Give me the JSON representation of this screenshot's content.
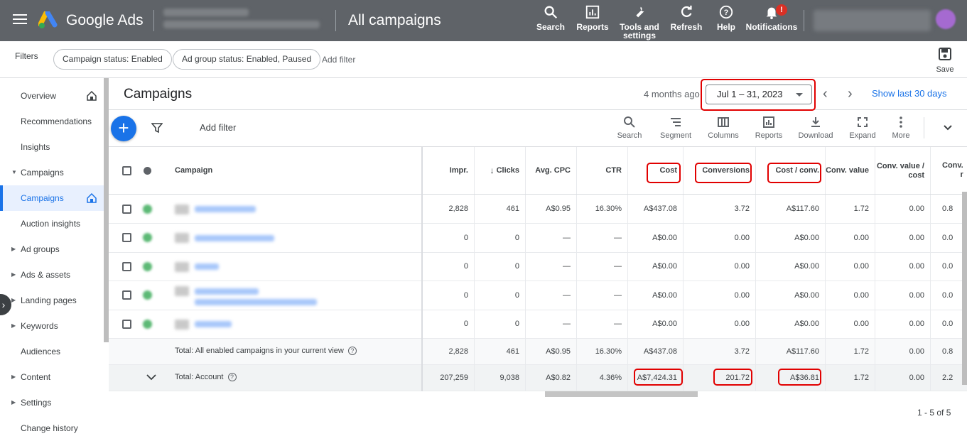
{
  "app": {
    "brand": "Google Ads",
    "page_title": "All campaigns"
  },
  "topnav": [
    {
      "label": "Search",
      "icon": "search-icon"
    },
    {
      "label": "Reports",
      "icon": "reports-icon"
    },
    {
      "label": "Tools and settings",
      "icon": "wrench-icon"
    },
    {
      "label": "Refresh",
      "icon": "refresh-icon"
    },
    {
      "label": "Help",
      "icon": "help-icon"
    },
    {
      "label": "Notifications",
      "icon": "bell-icon",
      "badge": "!"
    }
  ],
  "filterbar": {
    "label": "Filters",
    "chips": [
      "Campaign status: Enabled",
      "Ad group status: Enabled, Paused"
    ],
    "add_filter": "Add filter",
    "save": "Save"
  },
  "sidebar": {
    "items": [
      {
        "label": "Overview",
        "home": true
      },
      {
        "label": "Recommendations"
      },
      {
        "label": "Insights"
      },
      {
        "label": "Campaigns",
        "caret": "down"
      },
      {
        "label": "Campaigns",
        "active": true,
        "home": true
      },
      {
        "label": "Auction insights"
      },
      {
        "label": "Ad groups",
        "caret": "right"
      },
      {
        "label": "Ads & assets",
        "caret": "right"
      },
      {
        "label": "Landing pages",
        "caret": "right"
      },
      {
        "label": "Keywords",
        "caret": "right"
      },
      {
        "label": "Audiences"
      },
      {
        "label": "Content",
        "caret": "right"
      },
      {
        "label": "Settings",
        "caret": "right"
      },
      {
        "label": "Change history"
      }
    ]
  },
  "header": {
    "title": "Campaigns",
    "ago": "4 months ago",
    "date_range": "Jul 1 – 31, 2023",
    "show_last": "Show last 30 days"
  },
  "toolbar": {
    "add_filter": "Add filter",
    "tools": [
      {
        "label": "Search",
        "icon": "search-icon"
      },
      {
        "label": "Segment",
        "icon": "segment-icon"
      },
      {
        "label": "Columns",
        "icon": "columns-icon"
      },
      {
        "label": "Reports",
        "icon": "reports-icon"
      },
      {
        "label": "Download",
        "icon": "download-icon"
      },
      {
        "label": "Expand",
        "icon": "expand-icon"
      },
      {
        "label": "More",
        "icon": "more-vert-icon"
      }
    ]
  },
  "table": {
    "campaign_header": "Campaign",
    "columns": [
      "Impr.",
      "Clicks",
      "Avg. CPC",
      "CTR",
      "Cost",
      "Conversions",
      "Cost / conv.",
      "Conv. value",
      "Conv. value / cost",
      "Conv. r"
    ],
    "sort_arrow": "↓",
    "rows": [
      {
        "values": [
          "2,828",
          "461",
          "A$0.95",
          "16.30%",
          "A$437.08",
          "3.72",
          "A$117.60",
          "1.72",
          "0.00",
          "0.8"
        ]
      },
      {
        "values": [
          "0",
          "0",
          "—",
          "—",
          "A$0.00",
          "0.00",
          "A$0.00",
          "0.00",
          "0.00",
          "0.0"
        ]
      },
      {
        "values": [
          "0",
          "0",
          "—",
          "—",
          "A$0.00",
          "0.00",
          "A$0.00",
          "0.00",
          "0.00",
          "0.0"
        ]
      },
      {
        "values": [
          "0",
          "0",
          "—",
          "—",
          "A$0.00",
          "0.00",
          "A$0.00",
          "0.00",
          "0.00",
          "0.0"
        ]
      },
      {
        "values": [
          "0",
          "0",
          "—",
          "—",
          "A$0.00",
          "0.00",
          "A$0.00",
          "0.00",
          "0.00",
          "0.0"
        ]
      }
    ],
    "total_view": {
      "label": "Total: All enabled campaigns in your current view",
      "values": [
        "2,828",
        "461",
        "A$0.95",
        "16.30%",
        "A$437.08",
        "3.72",
        "A$117.60",
        "1.72",
        "0.00",
        "0.8"
      ]
    },
    "total_account": {
      "label": "Total: Account",
      "values": [
        "207,259",
        "9,038",
        "A$0.82",
        "4.36%",
        "A$7,424.31",
        "201.72",
        "A$36.81",
        "1.72",
        "0.00",
        "2.2"
      ]
    }
  },
  "pagination": "1 - 5 of 5",
  "colors": {
    "topbar": "#5f6368",
    "accent": "#1a73e8",
    "highlight": "#e10000"
  }
}
